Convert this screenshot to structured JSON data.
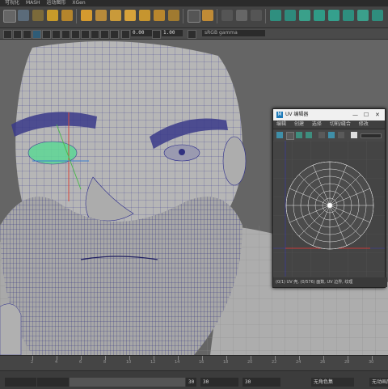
{
  "menubar": {
    "items": [
      "可视化",
      "MASH",
      "运动图形",
      "XGen"
    ]
  },
  "viewport_toolbar": {
    "field_a": "0.00",
    "field_b": "1.00",
    "color_space": "sRGB gamma"
  },
  "uv_editor": {
    "title": "UV 编辑器",
    "menu": [
      "编辑",
      "创建",
      "选择",
      "切割/缝合",
      "修改"
    ],
    "minimize": "—",
    "maximize": "☐",
    "close": "✕",
    "status": "(0/1) UV 壳, (0/576) 面数, UV 边界, 纹理"
  },
  "timeline": {
    "ticks": [
      "2",
      "4",
      "6",
      "8",
      "10",
      "12",
      "14",
      "16",
      "18",
      "20",
      "22",
      "24",
      "26",
      "28",
      "30"
    ]
  },
  "range_bar": {
    "start_field": "30",
    "end_field_a": "30",
    "end_field_b": "30",
    "character_set": "无角色集",
    "anim_layer": "无动画层"
  },
  "colors": {
    "wire": "#2a2a8c",
    "mesh": "#b4b4b4",
    "highlight": "#5fd896",
    "viewport_bg": "#656565",
    "shelf_bg": "#444444"
  }
}
